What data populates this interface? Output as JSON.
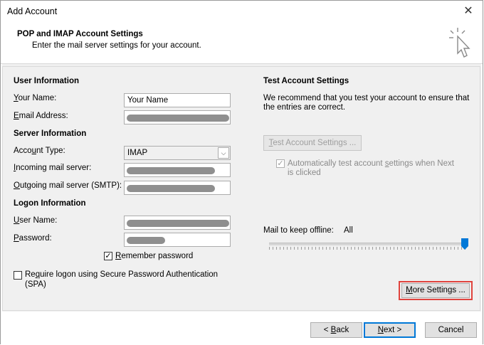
{
  "window": {
    "title": "Add Account",
    "close_glyph": "✕"
  },
  "header": {
    "title": "POP and IMAP Account Settings",
    "subtitle": "Enter the mail server settings for your account.",
    "icon": "cursor-click-icon"
  },
  "user_information": {
    "heading": "User Information",
    "your_name_label_u": "Y",
    "your_name_label_rest": "our Name:",
    "your_name_value": "Your Name",
    "email_label_u": "E",
    "email_label_rest": "mail Address:"
  },
  "server_information": {
    "heading": "Server Information",
    "account_type_label_pre": "Acco",
    "account_type_label_u": "u",
    "account_type_label_rest": "nt Type:",
    "account_type_value": "IMAP",
    "incoming_label_u": "I",
    "incoming_label_rest": "ncoming mail server:",
    "outgoing_label_u": "O",
    "outgoing_label_rest": "utgoing mail server (SMTP):"
  },
  "logon_information": {
    "heading": "Logon Information",
    "username_label_u": "U",
    "username_label_rest": "ser Name:",
    "password_label_u": "P",
    "password_label_rest": "assword:",
    "remember_label_u": "R",
    "remember_label_rest": "emember password",
    "remember_checked": true,
    "spa_label_pre": "Re",
    "spa_label_u": "q",
    "spa_label_rest": "uire logon using Secure Password Authentication",
    "spa_label_line2": "(SPA)",
    "spa_checked": false
  },
  "test_account": {
    "heading": "Test Account Settings",
    "description_line1": "We recommend that you test your account to ensure that",
    "description_line2": "the entries are correct.",
    "test_button_u": "T",
    "test_button_rest": "est Account Settings ...",
    "auto_test_pre": "Automatically test account ",
    "auto_test_u": "s",
    "auto_test_rest": "ettings when Next",
    "auto_test_line2": "is clicked",
    "auto_test_checked": true
  },
  "offline": {
    "label": "Mail to keep offline:",
    "value": "All",
    "slider_level": 1.0
  },
  "more_settings": {
    "label_u": "M",
    "label_rest": "ore Settings ..."
  },
  "footer": {
    "back_pre": "< ",
    "back_u": "B",
    "back_rest": "ack",
    "next_u": "N",
    "next_rest": "ext >",
    "cancel": "Cancel"
  },
  "colors": {
    "highlight": "#e0443e",
    "primary_border": "#0078d7",
    "slider_thumb": "#0078d7"
  }
}
